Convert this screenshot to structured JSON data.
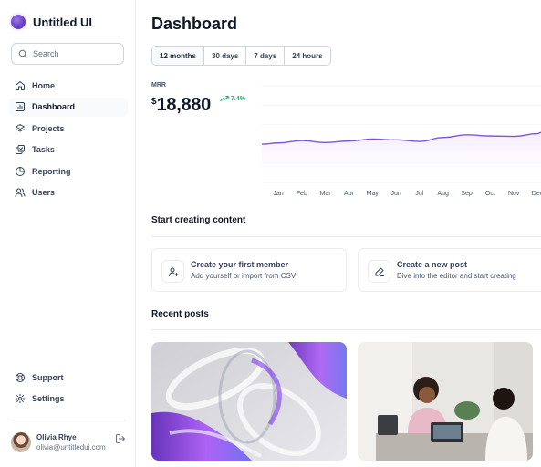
{
  "app": {
    "name": "Untitled UI"
  },
  "search": {
    "placeholder": "Search"
  },
  "sidebar": {
    "items": [
      {
        "label": "Home",
        "icon": "home-icon"
      },
      {
        "label": "Dashboard",
        "icon": "bar-chart-icon",
        "active": true
      },
      {
        "label": "Projects",
        "icon": "layers-icon"
      },
      {
        "label": "Tasks",
        "icon": "check-squares-icon"
      },
      {
        "label": "Reporting",
        "icon": "pie-chart-icon"
      },
      {
        "label": "Users",
        "icon": "users-icon"
      }
    ],
    "bottom_items": [
      {
        "label": "Support",
        "icon": "life-buoy-icon"
      },
      {
        "label": "Settings",
        "icon": "gear-icon"
      }
    ]
  },
  "user": {
    "name": "Olivia Rhye",
    "email": "olivia@untitledui.com"
  },
  "page": {
    "title": "Dashboard"
  },
  "filters": [
    {
      "label": "12 months",
      "active": true
    },
    {
      "label": "30 days"
    },
    {
      "label": "7 days"
    },
    {
      "label": "24 hours"
    }
  ],
  "mrr": {
    "label": "MRR",
    "currency": "$",
    "value": "18,880",
    "change": "7.4%",
    "change_color": "#12b76a"
  },
  "chart_data": {
    "type": "area",
    "categories": [
      "Jan",
      "Feb",
      "Mar",
      "Apr",
      "May",
      "Jun",
      "Jul",
      "Aug",
      "Sep",
      "Oct",
      "Nov",
      "Dec"
    ],
    "series": [
      {
        "values": [
          10.2,
          10.8,
          10.3,
          10.7,
          11.2,
          11.0,
          10.6,
          11.6,
          12.3,
          12.0,
          11.9,
          12.6
        ]
      }
    ],
    "ylim": [
      0,
      25
    ],
    "grid": true,
    "line_color": "#7f56d9",
    "fill_color": "#f4ebff"
  },
  "content_section": {
    "title": "Start creating content",
    "cards": [
      {
        "title": "Create your first member",
        "description": "Add yourself or import from CSV",
        "icon": "user-plus-icon"
      },
      {
        "title": "Create a new post",
        "description": "Dive into the editor and start creating",
        "icon": "pen-icon"
      }
    ]
  },
  "recent_posts": {
    "title": "Recent posts"
  }
}
